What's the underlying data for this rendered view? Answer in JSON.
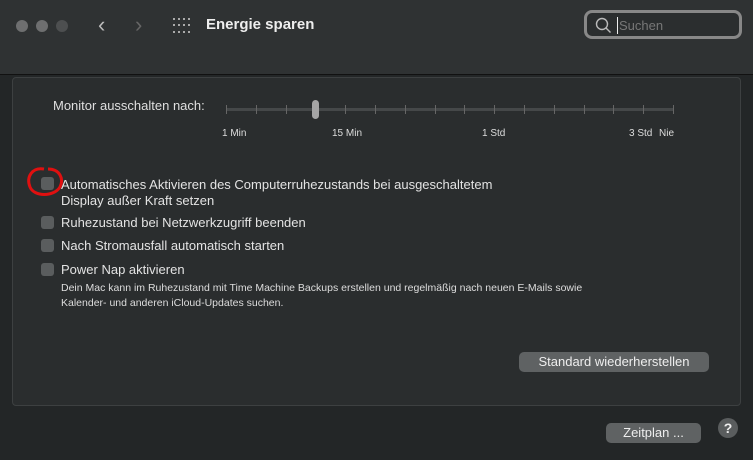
{
  "window": {
    "title": "Energie sparen"
  },
  "search": {
    "placeholder": "Suchen",
    "value": ""
  },
  "monitor": {
    "label": "Monitor ausschalten nach:",
    "tick_count": 16,
    "selected_tick_index": 3,
    "labels": [
      "1 Min",
      "15 Min",
      "1 Std",
      "3 Std",
      "Nie"
    ]
  },
  "options": [
    {
      "label_line1": "Automatisches Aktivieren des Computerruhezustands bei ausgeschaltetem",
      "label_line2": "Display außer Kraft setzen",
      "checked": false
    },
    {
      "label": "Ruhezustand bei Netzwerkzugriff beenden",
      "checked": false
    },
    {
      "label": "Nach Stromausfall automatisch starten",
      "checked": false
    },
    {
      "label": "Power Nap aktivieren",
      "checked": false
    }
  ],
  "power_nap_description_line1": "Dein Mac kann im Ruhezustand mit Time Machine Backups erstellen und regelmäßig nach neuen E-Mails sowie",
  "power_nap_description_line2": "Kalender- und anderen iCloud-Updates suchen.",
  "buttons": {
    "restore_defaults": "Standard wiederherstellen",
    "schedule": "Zeitplan ...",
    "help": "?"
  }
}
